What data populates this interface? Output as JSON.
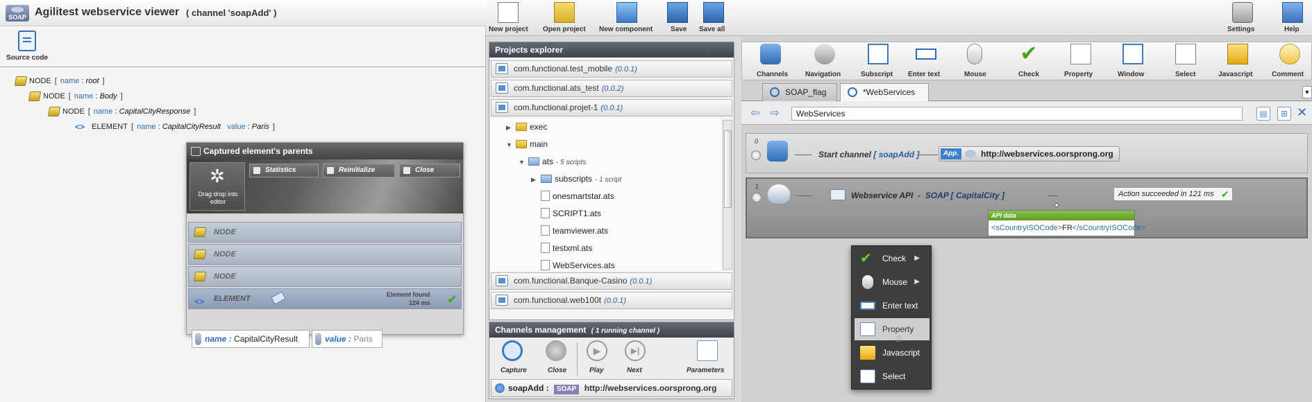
{
  "viewer": {
    "title": "Agilitest webservice viewer",
    "channel": "( channel 'soapAdd' )",
    "logo_text": "SOAP",
    "source_code_label": "Source code",
    "tree": [
      {
        "type": "NODE",
        "attrs": [
          {
            "k": "name",
            "v": "root"
          }
        ]
      },
      {
        "type": "NODE",
        "attrs": [
          {
            "k": "name",
            "v": "Body"
          }
        ]
      },
      {
        "type": "NODE",
        "attrs": [
          {
            "k": "name",
            "v": "CapitalCityResponse"
          }
        ]
      },
      {
        "type": "ELEMENT",
        "attrs": [
          {
            "k": "name",
            "v": "CapitalCityResult"
          },
          {
            "k": "value",
            "v": "Paris"
          }
        ]
      }
    ],
    "sep_open": "[",
    "sep_close": "]",
    "colon": ":"
  },
  "captured": {
    "title": "Captured element's parents",
    "drag_label": "Drag drop into editor",
    "buttons": {
      "statistics": "Statistics",
      "reinitialize": "Reinitialize",
      "close": "Close"
    },
    "rows": [
      "NODE",
      "NODE",
      "NODE",
      "ELEMENT"
    ],
    "element_found": "Element found",
    "element_time": "124 ms",
    "attr_name_key": "name :",
    "attr_name_val": "CapitalCityResult",
    "attr_value_key": "value :",
    "attr_value_val": "Paris"
  },
  "toolbar": {
    "new_project": "New project",
    "open_project": "Open project",
    "new_component": "New component",
    "save": "Save",
    "save_all": "Save all",
    "settings": "Settings",
    "help": "Help"
  },
  "projects": {
    "title": "Projects explorer",
    "list_top": [
      {
        "name": "com.functional.test_mobile",
        "ver": "(0.0.1)"
      },
      {
        "name": "com.functional.ats_test",
        "ver": "(0.0.2)"
      },
      {
        "name": "com.functional.projet-1",
        "ver": "(0.0.1)"
      }
    ],
    "tree": {
      "exec": "exec",
      "main": "main",
      "ats": "ats",
      "ats_note": "- 5 scripts",
      "subscripts": "subscripts",
      "subscripts_note": "- 1 script",
      "files": [
        "onesmartstar.ats",
        "SCRIPT1.ats",
        "teamviewer.ats",
        "testxml.ats",
        "WebServices.ats"
      ]
    },
    "list_bottom": [
      {
        "name": "com.functional.Banque-Casino",
        "ver": "(0.0.1)"
      },
      {
        "name": "com.functional.web100t",
        "ver": "(0.0.1)"
      }
    ]
  },
  "channels": {
    "title": "Channels management",
    "subtitle": "( 1 running channel )",
    "buttons": {
      "capture": "Capture",
      "close": "Close",
      "play": "Play",
      "next": "Next",
      "parameters": "Parameters"
    },
    "running_name": "soapAdd :",
    "running_type": "SOAP",
    "running_url": "http://webservices.oorsprong.org"
  },
  "editor": {
    "toolbar": [
      "Channels",
      "Navigation",
      "Subscript",
      "Enter text",
      "Mouse",
      "Check",
      "Property",
      "Window",
      "Select",
      "Javascript",
      "Comment"
    ],
    "tabs": [
      {
        "label": "SOAP_flag"
      },
      {
        "label": "*WebServices"
      }
    ],
    "address": "WebServices",
    "actions": [
      {
        "index": "0",
        "text": "Start channel",
        "bold": "[ soapAdd ]",
        "app_badge": "App.",
        "url": "http://webservices.oorsprong.org"
      },
      {
        "index": "1",
        "text": "Webservice API",
        "sep": "-",
        "bold": "SOAP [ CapitalCity ]",
        "status": "Action succeeded in 121 ms",
        "api_title": "API data",
        "api_open": "<sCountryISOCode>",
        "api_value": "FR",
        "api_close": "</sCountryISOCode>"
      }
    ]
  },
  "context_menu": [
    {
      "label": "Check",
      "submenu": true,
      "icon": "check-icon"
    },
    {
      "label": "Mouse",
      "submenu": true,
      "icon": "mouse-icon"
    },
    {
      "label": "Enter text",
      "submenu": false,
      "icon": "keyboard-icon"
    },
    {
      "label": "Property",
      "submenu": false,
      "icon": "property-icon",
      "highlighted": true
    },
    {
      "label": "Javascript",
      "submenu": false,
      "icon": "javascript-icon"
    },
    {
      "label": "Select",
      "submenu": false,
      "icon": "select-icon"
    }
  ],
  "colors": {
    "accent": "#2f6db5",
    "success": "#4aa21e",
    "panel_head": "#3e444d",
    "menu_bg": "#3e3e3e"
  }
}
